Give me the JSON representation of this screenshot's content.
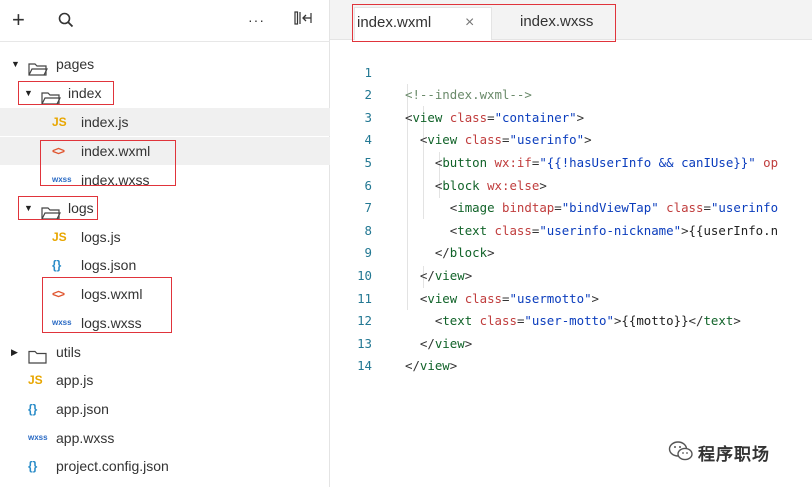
{
  "explorer": {
    "toolbar": {
      "add": "+",
      "more": "···"
    },
    "tree": [
      {
        "label": "pages",
        "kind": "folder",
        "expanded": true
      },
      {
        "label": "index",
        "kind": "folder",
        "expanded": true
      },
      {
        "label": "index.js",
        "kind": "file",
        "icon": "JS"
      },
      {
        "label": "index.wxml",
        "kind": "file",
        "icon": "<>"
      },
      {
        "label": "index.wxss",
        "kind": "file",
        "icon": "wxss"
      },
      {
        "label": "logs",
        "kind": "folder",
        "expanded": true
      },
      {
        "label": "logs.js",
        "kind": "file",
        "icon": "JS"
      },
      {
        "label": "logs.json",
        "kind": "file",
        "icon": "{}"
      },
      {
        "label": "logs.wxml",
        "kind": "file",
        "icon": "<>"
      },
      {
        "label": "logs.wxss",
        "kind": "file",
        "icon": "wxss"
      },
      {
        "label": "utils",
        "kind": "folder",
        "expanded": false
      },
      {
        "label": "app.js",
        "kind": "file",
        "icon": "JS"
      },
      {
        "label": "app.json",
        "kind": "file",
        "icon": "{}"
      },
      {
        "label": "app.wxss",
        "kind": "file",
        "icon": "wxss"
      },
      {
        "label": "project.config.json",
        "kind": "file",
        "icon": "{}"
      }
    ],
    "icons": {
      "js": "JS",
      "xml": "<>",
      "wxss": "wxss",
      "json": "{}"
    }
  },
  "editor": {
    "tabs": [
      {
        "label": "index.wxml",
        "close": "×"
      },
      {
        "label": "index.wxss"
      }
    ],
    "line_numbers": [
      "1",
      "2",
      "3",
      "4",
      "5",
      "6",
      "7",
      "8",
      "9",
      "10",
      "11",
      "12",
      "13",
      "14"
    ],
    "code": {
      "l1": {
        "comment": "<!--index.wxml-->"
      },
      "l2": {
        "open": "<",
        "tag": "view",
        "attr": "class",
        "eq": "=",
        "val": "\"container\"",
        "close": ">"
      },
      "l3": {
        "open": "<",
        "tag": "view",
        "attr": "class",
        "eq": "=",
        "val": "\"userinfo\"",
        "close": ">"
      },
      "l4": {
        "open": "<",
        "tag": "button",
        "attr": "wx:if",
        "eq": "=",
        "val": "\"{{!hasUserInfo && canIUse}}\"",
        "rest": " op"
      },
      "l5": {
        "open": "<",
        "tag": "block",
        "attr": "wx:else",
        "close": ">"
      },
      "l6": {
        "open": "<",
        "tag": "image",
        "attr": "bindtap",
        "eq": "=",
        "val": "\"bindViewTap\"",
        "attr2": "class",
        "eq2": "=",
        "val2": "\"userinfo"
      },
      "l7": {
        "open": "<",
        "tag": "text",
        "attr": "class",
        "eq": "=",
        "val": "\"userinfo-nickname\"",
        "close": ">",
        "text": "{{userInfo.n"
      },
      "l8": {
        "open": "</",
        "tag": "block",
        "close": ">"
      },
      "l9": {
        "open": "</",
        "tag": "view",
        "close": ">"
      },
      "l10": {
        "open": "<",
        "tag": "view",
        "attr": "class",
        "eq": "=",
        "val": "\"usermotto\"",
        "close": ">"
      },
      "l11": {
        "open": "<",
        "tag": "text",
        "attr": "class",
        "eq": "=",
        "val": "\"user-motto\"",
        "close": ">",
        "text": "{{motto}}",
        "open2": "</",
        "tag2": "text",
        "close2": ">"
      },
      "l12": {
        "open": "</",
        "tag": "view",
        "close": ">"
      },
      "l13": {
        "open": "</",
        "tag": "view",
        "close": ">"
      },
      "l14": {}
    }
  },
  "watermark": {
    "text": "程序职场"
  },
  "colors": {
    "highlight_box": "#e0343b",
    "js_icon": "#e8a600",
    "xml_icon": "#e0552f",
    "wxss_icon": "#2a6ac4",
    "json_icon": "#2a8cc8"
  }
}
